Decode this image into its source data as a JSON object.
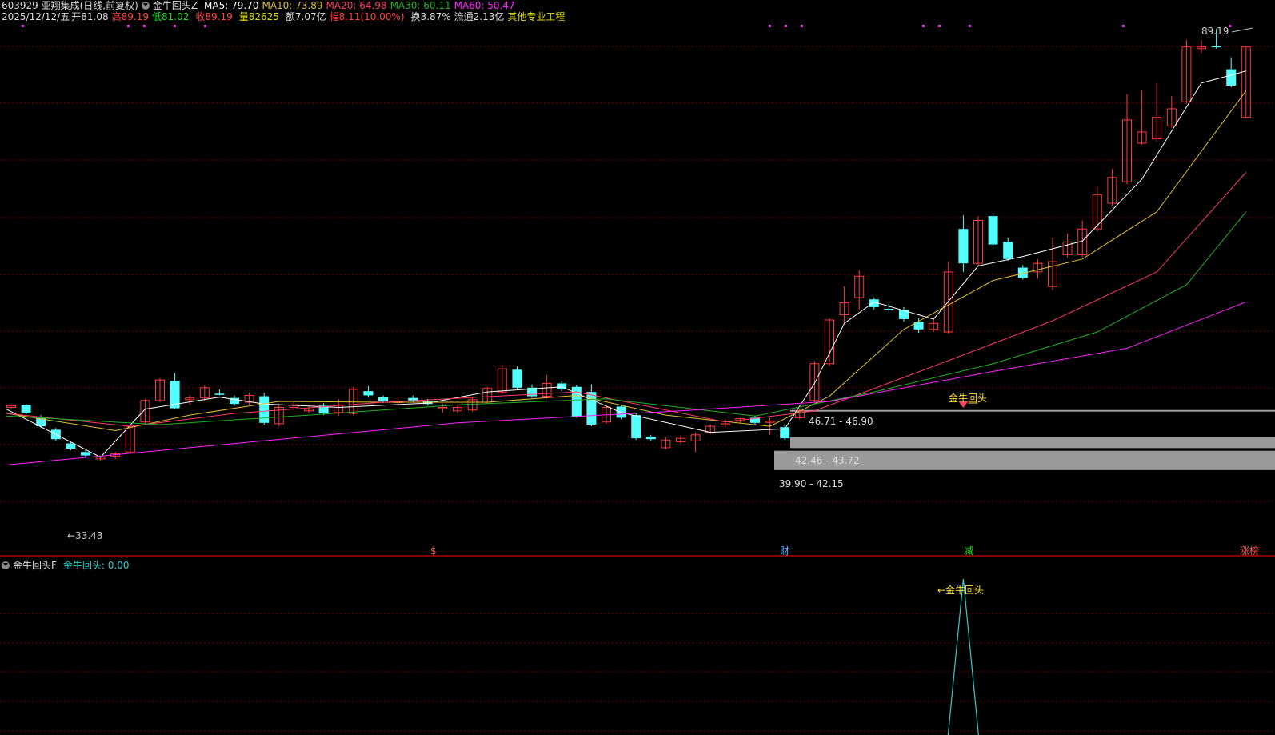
{
  "header": {
    "code_name": "603929 亚翔集成(日线,前复权)",
    "indicator_name": "金牛回头Z",
    "ma5": "MA5: 79.70",
    "ma10": "MA10: 73.89",
    "ma20": "MA20: 64.98",
    "ma30": "MA30: 60.11",
    "ma60": "MA60: 50.47",
    "date": "2025/12/12/五",
    "open_label": "开",
    "open": "81.08",
    "high_label": "高",
    "high": "89.19",
    "low_label": "低",
    "low": "81.02",
    "close_label": "收",
    "close": "89.19",
    "volume_label": "量",
    "volume": "82625",
    "amount": "额7.07亿",
    "range_label": "幅",
    "range": "8.11(10.00%)",
    "turnover": "换3.87%",
    "float": "流通2.13亿",
    "industry": "其他专业工程"
  },
  "colors": {
    "up": "#ff3a3a",
    "down": "#54ffff",
    "ma5": "#ffffff",
    "ma10": "#e0c030",
    "ma20": "#ff3a6a",
    "ma30": "#22b022",
    "ma60": "#ff22ff",
    "grid": "#7a0000",
    "signal": "#ffe030",
    "zone": "#9a9a9a",
    "industry": "#e0e000"
  },
  "annotations": {
    "max_price": "89.19",
    "min_price": "←33.43",
    "signal_main": "金牛回头",
    "zone1": "46.71 - 46.90",
    "zone2": "42.46 - 43.72",
    "zone3": "39.90 - 42.15",
    "event_dollar": "$",
    "event_cai": "财",
    "event_jian": "减",
    "event_zhangbang": "涨榜"
  },
  "sub_panel": {
    "indicator_name": "金牛回头F",
    "value_text": "金牛回头: 0.00",
    "signal_text": "←金牛回头"
  },
  "chart_data": {
    "type": "candlestick",
    "price_range": [
      31.5,
      91.5
    ],
    "candles": [
      [
        47.2,
        47.4,
        47.0,
        47.3
      ],
      [
        47.5,
        46.6,
        46.4,
        47.6
      ],
      [
        46.1,
        45.0,
        44.8,
        46.3
      ],
      [
        44.6,
        43.5,
        43.3,
        44.8
      ],
      [
        43.0,
        42.4,
        42.2,
        43.2
      ],
      [
        42.0,
        41.6,
        41.4,
        42.2
      ],
      [
        41.2,
        41.4,
        41.0,
        41.6
      ],
      [
        41.5,
        41.8,
        41.2,
        42.0
      ],
      [
        42.0,
        45.0,
        41.8,
        45.2
      ],
      [
        45.5,
        48.0,
        45.3,
        48.2
      ],
      [
        48.0,
        50.4,
        47.8,
        50.6
      ],
      [
        50.3,
        47.1,
        47.0,
        51.2
      ],
      [
        48.1,
        48.3,
        47.5,
        48.6
      ],
      [
        48.3,
        49.5,
        48.0,
        49.8
      ],
      [
        48.8,
        48.7,
        48.6,
        49.3
      ],
      [
        48.3,
        47.6,
        47.4,
        48.6
      ],
      [
        47.8,
        48.6,
        47.5,
        48.9
      ],
      [
        48.5,
        45.4,
        45.2,
        48.9
      ],
      [
        45.3,
        47.2,
        45.0,
        47.6
      ],
      [
        47.2,
        47.5,
        46.9,
        47.8
      ],
      [
        46.8,
        47.0,
        46.5,
        47.3
      ],
      [
        47.4,
        46.5,
        46.3,
        47.7
      ],
      [
        46.6,
        47.5,
        46.2,
        48.2
      ],
      [
        46.5,
        49.3,
        46.3,
        49.6
      ],
      [
        49.1,
        48.6,
        48.4,
        49.7
      ],
      [
        48.4,
        47.9,
        47.7,
        48.6
      ],
      [
        47.8,
        47.9,
        47.6,
        48.4
      ],
      [
        48.3,
        48.0,
        47.8,
        48.6
      ],
      [
        47.9,
        47.6,
        47.4,
        48.2
      ],
      [
        47.1,
        47.2,
        46.6,
        47.6
      ],
      [
        46.8,
        47.2,
        46.5,
        47.5
      ],
      [
        46.9,
        48.1,
        46.7,
        48.4
      ],
      [
        47.8,
        49.4,
        47.6,
        49.6
      ],
      [
        49.0,
        51.7,
        48.8,
        52.2
      ],
      [
        51.6,
        49.5,
        49.3,
        52.0
      ],
      [
        49.5,
        48.5,
        48.3,
        49.9
      ],
      [
        48.5,
        50.0,
        48.3,
        51.0
      ],
      [
        50.0,
        49.3,
        49.1,
        50.3
      ],
      [
        49.6,
        46.1,
        46.0,
        49.8
      ],
      [
        49.0,
        45.2,
        45.0,
        49.9
      ],
      [
        45.5,
        47.2,
        45.3,
        47.5
      ],
      [
        47.3,
        46.0,
        45.8,
        47.4
      ],
      [
        46.3,
        43.6,
        43.4,
        46.5
      ],
      [
        43.8,
        43.5,
        43.3,
        44.0
      ],
      [
        42.5,
        43.4,
        42.3,
        43.7
      ],
      [
        43.2,
        43.6,
        43.0,
        43.9
      ],
      [
        43.3,
        44.0,
        42.0,
        44.3
      ],
      [
        44.3,
        45.0,
        44.1,
        45.2
      ],
      [
        45.2,
        45.3,
        44.9,
        45.8
      ],
      [
        45.6,
        45.9,
        45.4,
        46.0
      ],
      [
        46.0,
        45.4,
        45.2,
        46.2
      ],
      [
        45.5,
        45.6,
        44.0,
        46.0
      ],
      [
        44.9,
        43.6,
        43.4,
        45.3
      ],
      [
        46.0,
        46.8,
        45.8,
        47.1
      ],
      [
        48.0,
        52.3,
        47.8,
        52.6
      ],
      [
        52.3,
        57.4,
        52.0,
        57.6
      ],
      [
        58.0,
        59.4,
        57.0,
        61.3
      ],
      [
        60.0,
        62.5,
        58.5,
        63.2
      ],
      [
        59.8,
        58.9,
        58.6,
        60.0
      ],
      [
        58.7,
        58.6,
        58.2,
        59.3
      ],
      [
        58.6,
        57.5,
        57.2,
        58.9
      ],
      [
        57.2,
        56.3,
        55.9,
        57.6
      ],
      [
        56.3,
        57.0,
        56.0,
        57.5
      ],
      [
        56.0,
        63.0,
        55.8,
        64.2
      ],
      [
        68.0,
        64.0,
        63.0,
        69.6
      ],
      [
        64.0,
        69.0,
        63.7,
        69.5
      ],
      [
        69.5,
        66.2,
        66.0,
        69.9
      ],
      [
        66.5,
        64.5,
        64.3,
        67.0
      ],
      [
        63.5,
        62.3,
        62.1,
        63.8
      ],
      [
        63.0,
        64.0,
        62.2,
        64.5
      ],
      [
        61.3,
        64.2,
        60.9,
        67.0
      ],
      [
        65.0,
        66.5,
        64.7,
        67.5
      ],
      [
        65.0,
        68.0,
        64.7,
        69.0
      ],
      [
        68.0,
        72.0,
        67.7,
        73.0
      ],
      [
        71.0,
        74.0,
        70.7,
        75.0
      ],
      [
        73.5,
        80.7,
        73.2,
        83.7
      ],
      [
        78.0,
        79.3,
        77.8,
        84.2
      ],
      [
        78.5,
        81.0,
        78.2,
        85.0
      ],
      [
        80.0,
        82.0,
        79.8,
        83.5
      ],
      [
        82.8,
        89.2,
        82.6,
        90.0
      ],
      [
        89.0,
        89.2,
        88.5,
        90.0
      ],
      [
        89.3,
        89.2,
        89.0,
        91.3
      ],
      [
        86.6,
        84.7,
        84.5,
        88.0
      ],
      [
        81.0,
        89.2,
        80.9,
        89.2
      ]
    ],
    "ma_series": [
      {
        "name": "MA5",
        "value": "79.70",
        "start": [
          0,
          47.0
        ],
        "points": [
          [
            6,
            41.4
          ],
          [
            9,
            47.0
          ],
          [
            14,
            48.4
          ],
          [
            17,
            47.6
          ],
          [
            22,
            47.2
          ],
          [
            28,
            47.7
          ],
          [
            32,
            49.0
          ],
          [
            37,
            49.6
          ],
          [
            41,
            46.6
          ],
          [
            47,
            44.3
          ],
          [
            52,
            44.7
          ],
          [
            54,
            50.0
          ],
          [
            56,
            57.0
          ],
          [
            58,
            59.5
          ],
          [
            62,
            57.5
          ],
          [
            65,
            63.7
          ],
          [
            68,
            64.8
          ],
          [
            72,
            66.6
          ],
          [
            76,
            73.8
          ],
          [
            80,
            85.0
          ],
          [
            83,
            86.4
          ]
        ]
      },
      {
        "name": "MA10",
        "value": "73.89",
        "start": [
          0,
          46.5
        ],
        "points": [
          [
            7,
            44.5
          ],
          [
            12,
            46.3
          ],
          [
            18,
            47.9
          ],
          [
            25,
            47.8
          ],
          [
            32,
            47.8
          ],
          [
            38,
            48.6
          ],
          [
            44,
            46.3
          ],
          [
            51,
            45.0
          ],
          [
            55,
            48.5
          ],
          [
            60,
            56.3
          ],
          [
            66,
            62.0
          ],
          [
            72,
            64.5
          ],
          [
            77,
            70.0
          ],
          [
            83,
            84.1
          ]
        ]
      },
      {
        "name": "MA20",
        "value": "64.98",
        "start": [
          0,
          46.5
        ],
        "points": [
          [
            8,
            45.0
          ],
          [
            15,
            46.5
          ],
          [
            25,
            47.8
          ],
          [
            38,
            49.0
          ],
          [
            48,
            45.5
          ],
          [
            54,
            46.8
          ],
          [
            62,
            52.0
          ],
          [
            70,
            57.3
          ],
          [
            77,
            63.0
          ],
          [
            83,
            74.6
          ]
        ]
      },
      {
        "name": "MA30",
        "value": "60.11",
        "start": [
          0,
          46.2
        ],
        "points": [
          [
            10,
            45.2
          ],
          [
            20,
            46.3
          ],
          [
            30,
            47.5
          ],
          [
            40,
            48.2
          ],
          [
            50,
            46.2
          ],
          [
            58,
            49.0
          ],
          [
            66,
            52.3
          ],
          [
            73,
            56.0
          ],
          [
            79,
            61.5
          ],
          [
            83,
            70.0
          ]
        ]
      },
      {
        "name": "MA60",
        "value": "50.47",
        "start": [
          0,
          40.5
        ],
        "points": [
          [
            15,
            43.0
          ],
          [
            30,
            45.4
          ],
          [
            45,
            46.8
          ],
          [
            55,
            47.9
          ],
          [
            66,
            51.4
          ],
          [
            75,
            54.1
          ],
          [
            83,
            59.5
          ]
        ]
      }
    ],
    "zones": [
      [
        46.71,
        46.9
      ],
      [
        42.46,
        43.72
      ],
      [
        39.9,
        42.15
      ]
    ],
    "signal_index": 64
  }
}
